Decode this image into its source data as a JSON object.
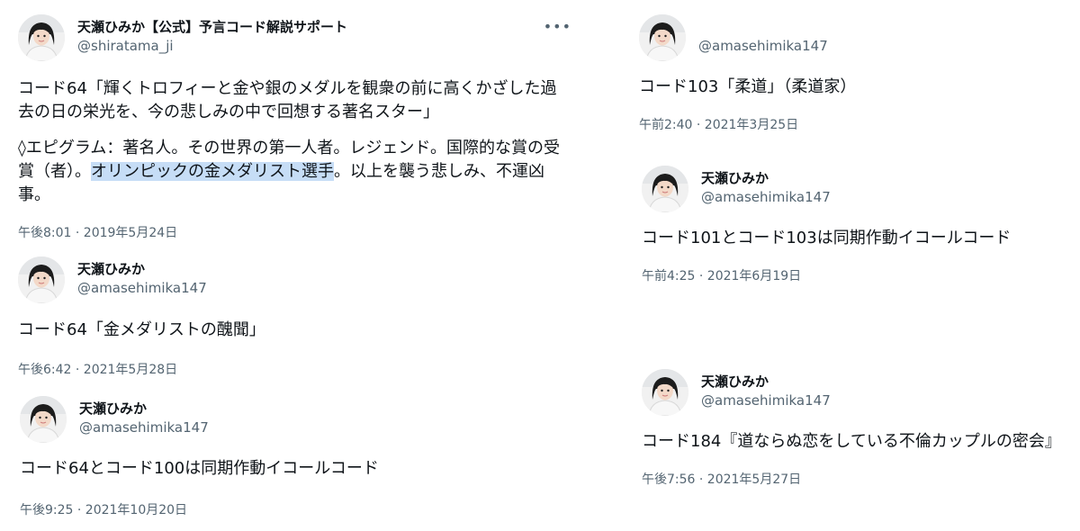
{
  "colors": {
    "text": "#0f1419",
    "secondary": "#536471",
    "highlight": "#c6ddf6"
  },
  "left_column": [
    {
      "name": "天瀬ひみか【公式】予言コード解説サポート",
      "handle": "@shiratama_ji",
      "more_icon": "more-horizontal-icon",
      "paragraph1": "コード64「輝くトロフィーと金や銀のメダルを観衆の前に高くかざした過去の日の栄光を、今の悲しみの中で回想する著名スター」",
      "paragraph2_before": "◊エピグラム：著名人。その世界の第一人者。レジェンド。国際的な賞の受賞（者）。",
      "paragraph2_highlight": "オリンピックの金メダリスト選手",
      "paragraph2_after": "。以上を襲う悲しみ、不運凶事。",
      "timestamp": "午後8:01 · 2019年5月24日"
    },
    {
      "name": "天瀬ひみか",
      "handle": "@amasehimika147",
      "text": "コード64「金メダリストの醜聞」",
      "timestamp": "午後6:42 · 2021年5月28日"
    },
    {
      "name": "天瀬ひみか",
      "handle": "@amasehimika147",
      "text": "コード64とコード100は同期作動イコールコード",
      "timestamp": "午後9:25 · 2021年10月20日"
    }
  ],
  "right_column": [
    {
      "handle": "@amasehimika147",
      "text": "コード103「柔道」（柔道家）",
      "timestamp": "午前2:40 · 2021年3月25日"
    },
    {
      "name": "天瀬ひみか",
      "handle": "@amasehimika147",
      "text": "コード101とコード103は同期作動イコールコード",
      "timestamp": "午前4:25 · 2021年6月19日"
    },
    {
      "name": "天瀬ひみか",
      "handle": "@amasehimika147",
      "text": "コード184『道ならぬ恋をしている不倫カップルの密会』",
      "timestamp": "午後7:56 · 2021年5月27日"
    }
  ]
}
